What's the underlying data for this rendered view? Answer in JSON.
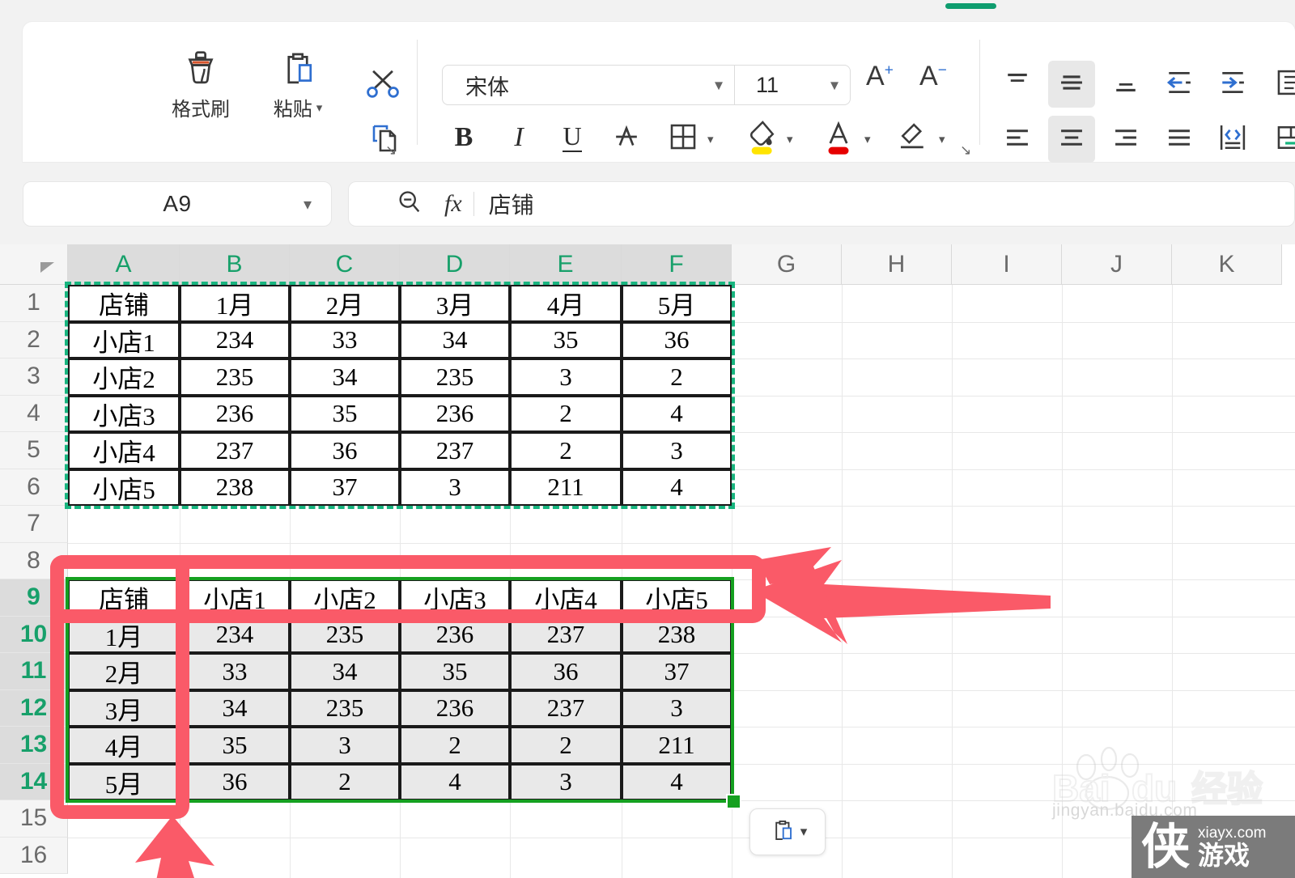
{
  "ribbon": {
    "active_tab_accent": "#0f9d6f",
    "clipboard": {
      "format_painter_label": "格式刷",
      "paste_label": "粘贴",
      "format_painter_icon": "format-painter-icon",
      "paste_icon": "clipboard-paste-icon",
      "cut_icon": "scissors-icon",
      "copy_icon": "copy-icon"
    },
    "font": {
      "family_value": "宋体",
      "size_value": "11",
      "bold_label": "B",
      "italic_label": "I",
      "underline_label": "U",
      "strikethrough_label": "A",
      "increase_font_label": "A",
      "decrease_font_label": "A",
      "increase_sup": "+",
      "decrease_sup": "−",
      "borders_icon": "borders-icon",
      "fill_color_icon": "fill-color-icon",
      "fill_color": "#ffe400",
      "font_color_icon": "font-color-icon",
      "font_color": "#e60000",
      "clear_format_icon": "clear-format-icon"
    },
    "align": {
      "top_icon": "align-top-icon",
      "middle_icon": "align-middle-icon",
      "bottom_icon": "align-bottom-icon",
      "decrease_indent_icon": "decrease-indent-icon",
      "increase_indent_icon": "increase-indent-icon",
      "wrap_text_icon": "wrap-text-icon",
      "left_icon": "align-left-icon",
      "center_icon": "align-center-icon",
      "right_icon": "align-right-icon",
      "justify_icon": "align-justify-icon",
      "orientation_icon": "text-orientation-icon",
      "merge_icon": "merge-cells-icon",
      "active_vertical": "middle",
      "active_horizontal": "center"
    }
  },
  "formula_bar": {
    "name_box_value": "A9",
    "name_box_chevron_icon": "chevron-down-icon",
    "lookup_icon": "search-icon",
    "fx_icon": "fx-icon",
    "cell_content": "店铺"
  },
  "sheet": {
    "column_headers": [
      "A",
      "B",
      "C",
      "D",
      "E",
      "F",
      "G",
      "H",
      "I",
      "J",
      "K"
    ],
    "selected_columns": [
      "A",
      "B",
      "C",
      "D",
      "E",
      "F"
    ],
    "row_headers": [
      "1",
      "2",
      "3",
      "4",
      "5",
      "6",
      "7",
      "8",
      "9",
      "10",
      "11",
      "12",
      "13",
      "14",
      "15",
      "16"
    ],
    "selected_rows": [
      "9",
      "10",
      "11",
      "12",
      "13",
      "14"
    ],
    "selection_range": "A9:F14",
    "copy_source_range": "A1:F6",
    "corner_icon": "select-all-icon",
    "fill_handle_icon": "fill-handle",
    "paste_options": {
      "icon": "clipboard-paste-icon",
      "chevron_icon": "chevron-down-icon"
    }
  },
  "table_source": {
    "headers": [
      "店铺",
      "1月",
      "2月",
      "3月",
      "4月",
      "5月"
    ],
    "rows": [
      [
        "小店1",
        "234",
        "33",
        "34",
        "35",
        "36"
      ],
      [
        "小店2",
        "235",
        "34",
        "235",
        "3",
        "2"
      ],
      [
        "小店3",
        "236",
        "35",
        "236",
        "2",
        "4"
      ],
      [
        "小店4",
        "237",
        "36",
        "237",
        "2",
        "3"
      ],
      [
        "小店5",
        "238",
        "37",
        "3",
        "211",
        "4"
      ]
    ]
  },
  "table_transposed": {
    "headers": [
      "店铺",
      "小店1",
      "小店2",
      "小店3",
      "小店4",
      "小店5"
    ],
    "rows": [
      [
        "1月",
        "234",
        "235",
        "236",
        "237",
        "238"
      ],
      [
        "2月",
        "33",
        "34",
        "35",
        "36",
        "37"
      ],
      [
        "3月",
        "34",
        "235",
        "236",
        "237",
        "3"
      ],
      [
        "4月",
        "35",
        "3",
        "2",
        "2",
        "211"
      ],
      [
        "5月",
        "36",
        "2",
        "4",
        "3",
        "4"
      ]
    ]
  },
  "annotations": {
    "highlight_color": "#fa5a68",
    "header_row_rect": "row-9-highlight",
    "first_column_rect": "column-a-highlight",
    "arrow_long_right": "arrow-pointing-left-long",
    "arrow_short": "arrow-pointing-down-left",
    "arrow_bottom": "arrow-pointing-up"
  },
  "watermarks": {
    "baidu_text": "Baidu 经验",
    "baidu_jingyan_url": "jingyan.baidu.com",
    "badge_char": "侠",
    "badge_url": "xiayx.com",
    "badge_text": "游戏"
  }
}
